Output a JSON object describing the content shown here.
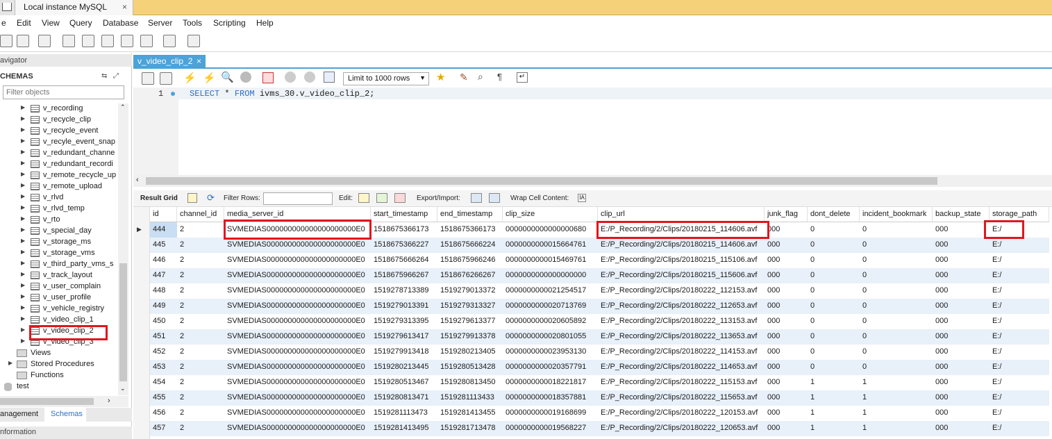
{
  "titlebar": {
    "tab_label": "Local instance MySQL",
    "close": "×"
  },
  "menu": [
    "e",
    "Edit",
    "View",
    "Query",
    "Database",
    "Server",
    "Tools",
    "Scripting",
    "Help"
  ],
  "navigator": {
    "header": "avigator",
    "schemas_header": "CHEMAS",
    "filter_placeholder": "Filter objects",
    "tables": [
      "v_recording",
      "v_recycle_clip",
      "v_recycle_event",
      "v_recyle_event_snap",
      "v_redundant_channe",
      "v_redundant_recordi",
      "v_remote_recycle_up",
      "v_remote_upload",
      "v_rlvd",
      "v_rlvd_temp",
      "v_rto",
      "v_special_day",
      "v_storage_ms",
      "v_storage_vms",
      "v_third_party_vms_s",
      "v_track_layout",
      "v_user_complain",
      "v_user_profile",
      "v_vehicle_registry",
      "v_video_clip_1",
      "v_video_clip_2",
      "v_video_clip_3"
    ],
    "groups": [
      "Views",
      "Stored Procedures",
      "Functions"
    ],
    "schema_test": "test",
    "tab_management": "anagement",
    "tab_schemas": "Schemas",
    "info_header": "nformation"
  },
  "editor": {
    "tab_label": "v_video_clip_2",
    "close": "×",
    "limit": "Limit to 1000 rows",
    "line_number": "1",
    "sql_keyword_select": "SELECT",
    "sql_star": " * ",
    "sql_keyword_from": "FROM",
    "sql_rest": " ivms_30.v_video_clip_2;"
  },
  "result_toolbar": {
    "result_grid": "Result Grid",
    "filter_rows": "Filter Rows:",
    "edit": "Edit:",
    "export_import": "Export/Import:",
    "wrap": "Wrap Cell Content:"
  },
  "grid": {
    "columns": [
      "id",
      "channel_id",
      "media_server_id",
      "start_timestamp",
      "end_timestamp",
      "clip_size",
      "clip_url",
      "junk_flag",
      "dont_delete",
      "incident_bookmark",
      "backup_state",
      "storage_path"
    ],
    "rows": [
      [
        "444",
        "2",
        "SVMEDIAS000000000000000000000E0",
        "1518675366173",
        "1518675366173",
        "0000000000000000680",
        "E:/P_Recording/2/Clips/20180215_114606.avf",
        "000",
        "0",
        "0",
        "000",
        "E:/"
      ],
      [
        "445",
        "2",
        "SVMEDIAS000000000000000000000E0",
        "1518675366227",
        "1518675666224",
        "0000000000015664761",
        "E:/P_Recording/2/Clips/20180215_114606.avf",
        "000",
        "0",
        "0",
        "000",
        "E:/"
      ],
      [
        "446",
        "2",
        "SVMEDIAS000000000000000000000E0",
        "1518675666264",
        "1518675966246",
        "0000000000015469761",
        "E:/P_Recording/2/Clips/20180215_115106.avf",
        "000",
        "0",
        "0",
        "000",
        "E:/"
      ],
      [
        "447",
        "2",
        "SVMEDIAS000000000000000000000E0",
        "1518675966267",
        "1518676266267",
        "0000000000000000000",
        "E:/P_Recording/2/Clips/20180215_115606.avf",
        "000",
        "0",
        "0",
        "000",
        "E:/"
      ],
      [
        "448",
        "2",
        "SVMEDIAS000000000000000000000E0",
        "1519278713389",
        "1519279013372",
        "0000000000021254517",
        "E:/P_Recording/2/Clips/20180222_112153.avf",
        "000",
        "0",
        "0",
        "000",
        "E:/"
      ],
      [
        "449",
        "2",
        "SVMEDIAS000000000000000000000E0",
        "1519279013391",
        "1519279313327",
        "0000000000020713769",
        "E:/P_Recording/2/Clips/20180222_112653.avf",
        "000",
        "0",
        "0",
        "000",
        "E:/"
      ],
      [
        "450",
        "2",
        "SVMEDIAS000000000000000000000E0",
        "1519279313395",
        "1519279613377",
        "0000000000020605892",
        "E:/P_Recording/2/Clips/20180222_113153.avf",
        "000",
        "0",
        "0",
        "000",
        "E:/"
      ],
      [
        "451",
        "2",
        "SVMEDIAS000000000000000000000E0",
        "1519279613417",
        "1519279913378",
        "0000000000020801055",
        "E:/P_Recording/2/Clips/20180222_113653.avf",
        "000",
        "0",
        "0",
        "000",
        "E:/"
      ],
      [
        "452",
        "2",
        "SVMEDIAS000000000000000000000E0",
        "1519279913418",
        "1519280213405",
        "0000000000023953130",
        "E:/P_Recording/2/Clips/20180222_114153.avf",
        "000",
        "0",
        "0",
        "000",
        "E:/"
      ],
      [
        "453",
        "2",
        "SVMEDIAS000000000000000000000E0",
        "1519280213445",
        "1519280513428",
        "0000000000020357791",
        "E:/P_Recording/2/Clips/20180222_114653.avf",
        "000",
        "0",
        "0",
        "000",
        "E:/"
      ],
      [
        "454",
        "2",
        "SVMEDIAS000000000000000000000E0",
        "1519280513467",
        "1519280813450",
        "0000000000018221817",
        "E:/P_Recording/2/Clips/20180222_115153.avf",
        "000",
        "1",
        "1",
        "000",
        "E:/"
      ],
      [
        "455",
        "2",
        "SVMEDIAS000000000000000000000E0",
        "1519280813471",
        "1519281113433",
        "0000000000018357881",
        "E:/P_Recording/2/Clips/20180222_115653.avf",
        "000",
        "1",
        "1",
        "000",
        "E:/"
      ],
      [
        "456",
        "2",
        "SVMEDIAS000000000000000000000E0",
        "1519281113473",
        "1519281413455",
        "0000000000019168699",
        "E:/P_Recording/2/Clips/20180222_120153.avf",
        "000",
        "1",
        "1",
        "000",
        "E:/"
      ],
      [
        "457",
        "2",
        "SVMEDIAS000000000000000000000E0",
        "1519281413495",
        "1519281713478",
        "0000000000019568227",
        "E:/P_Recording/2/Clips/20180222_120653.avf",
        "000",
        "1",
        "1",
        "000",
        "E:/"
      ]
    ]
  },
  "colors": {
    "accent": "#4ba3d9",
    "highlight": "#e0161f",
    "titlebar": "#f5d17a",
    "alt_row": "#e8f0f9"
  }
}
